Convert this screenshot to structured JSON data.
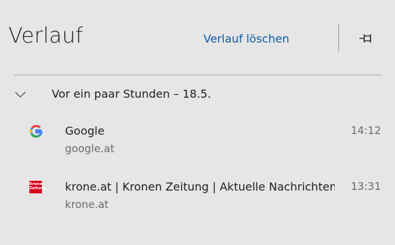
{
  "panel": {
    "title": "Verlauf",
    "clear_label": "Verlauf löschen",
    "pin_icon": "pin-icon"
  },
  "group": {
    "label": "Vor ein paar Stunden – 18.5.",
    "expanded": true
  },
  "entries": [
    {
      "title": "Google",
      "domain": "google.at",
      "time": "14:12",
      "icon": "google-favicon"
    },
    {
      "title": "krone.at | Kronen Zeitung | Aktuelle Nachrichten",
      "domain": "krone.at",
      "time": "13:31",
      "icon": "krone-favicon"
    }
  ],
  "colors": {
    "background": "#e6e6e6",
    "link": "#0f5ba6",
    "secondary_text": "#6b6b6b",
    "krone_red": "#d9001d"
  }
}
